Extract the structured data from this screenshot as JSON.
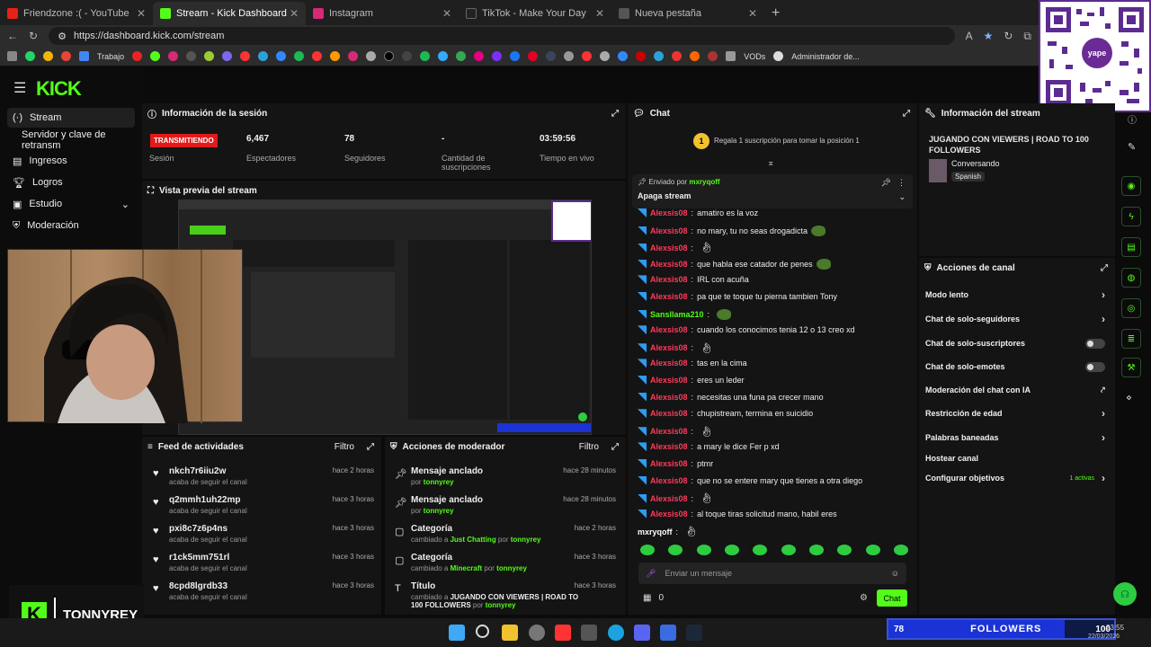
{
  "browser": {
    "tabs": [
      {
        "label": "Friendzone :( - YouTube",
        "color": "#e62117"
      },
      {
        "label": "Stream - Kick Dashboard",
        "color": "#53fc18"
      },
      {
        "label": "Instagram",
        "color": "#d62976"
      },
      {
        "label": "TikTok - Make Your Day",
        "color": "#222222"
      },
      {
        "label": "Nueva pestaña",
        "color": "#555555"
      }
    ],
    "url": "https://dashboard.kick.com/stream",
    "bookmarks": {
      "folder": "Trabajo",
      "vods": "VODs",
      "admin": "Administrador de..."
    }
  },
  "overlay": {
    "qr_brand": "yape",
    "streamer_name": "TONNYREY",
    "followers_count": "78",
    "followers_label": "FOLLOWERS",
    "followers_goal": "100",
    "followers_progress": 0.78,
    "clock_time": "23:55",
    "clock_date": "22/03/2026"
  },
  "sidebar": {
    "logo": "KICK",
    "items": [
      "Stream",
      "Servidor y clave de retransm",
      "Ingresos",
      "Logros",
      "Estudio",
      "Moderación"
    ]
  },
  "session": {
    "title": "Información de la sesión",
    "status": "TRANSMITIENDO",
    "status_label": "Sesión",
    "stats": [
      {
        "value": "6,467",
        "label": "Espectadores"
      },
      {
        "value": "78",
        "label": "Seguidores"
      },
      {
        "value": "-",
        "label": "Cantidad de suscripciones"
      },
      {
        "value": "03:59:56",
        "label": "Tiempo en vivo"
      }
    ]
  },
  "preview": {
    "title": "Vista previa del stream"
  },
  "feed": {
    "title": "Feed de actividades",
    "filter": "Filtro",
    "items": [
      {
        "name": "nkch7r6iiu2w",
        "sub": "acaba de seguir el canal",
        "time": "hace 2 horas"
      },
      {
        "name": "q2mmh1uh22mp",
        "sub": "acaba de seguir el canal",
        "time": "hace 3 horas"
      },
      {
        "name": "pxi8c7z6p4ns",
        "sub": "acaba de seguir el canal",
        "time": "hace 3 horas"
      },
      {
        "name": "r1ck5mm751rl",
        "sub": "acaba de seguir el canal",
        "time": "hace 3 horas"
      },
      {
        "name": "8cpd8lgrdb33",
        "sub": "acaba de seguir el canal",
        "time": "hace 3 horas"
      }
    ]
  },
  "mod": {
    "title": "Acciones de moderador",
    "filter": "Filtro",
    "items": [
      {
        "name": "Mensaje anclado",
        "pre": "por ",
        "a": "tonnyrey",
        "mid": "",
        "b": "",
        "time": "hace 28 minutos"
      },
      {
        "name": "Mensaje anclado",
        "pre": "por ",
        "a": "tonnyrey",
        "mid": "",
        "b": "",
        "time": "hace 28 minutos"
      },
      {
        "name": "Categoría",
        "pre": "cambiado a ",
        "a": "Just Chatting",
        "mid": " por ",
        "b": "tonnyrey",
        "time": "hace 2 horas"
      },
      {
        "name": "Categoría",
        "pre": "cambiado a ",
        "a": "Minecraft",
        "mid": " por ",
        "b": "tonnyrey",
        "time": "hace 3 horas"
      },
      {
        "name": "Título",
        "pre": "cambiado a ",
        "a": "JUGANDO CON VIEWERS | ROAD TO 100 FOLLOWERS",
        "mid": " por ",
        "b": "tonnyrey",
        "time": "hace 3 horas"
      }
    ]
  },
  "chat": {
    "title": "Chat",
    "gift_prompt": "Regala 1 suscripción para tomar la posición 1",
    "pinned_by_label": "Enviado por",
    "pinned_by": "mxryqoff",
    "pinned_msg": "Apaga stream",
    "messages": [
      {
        "user": "Alexsis08",
        "text": "amatiro es la voz",
        "extra": ""
      },
      {
        "user": "Alexsis08",
        "text": "no mary, tu no seas drogadicta",
        "extra": "emote"
      },
      {
        "user": "Alexsis08",
        "text": "",
        "extra": "hand"
      },
      {
        "user": "Alexsis08",
        "text": "que habla ese catador de penes",
        "extra": "emote"
      },
      {
        "user": "Alexsis08",
        "text": "IRL con acuña",
        "extra": ""
      },
      {
        "user": "Alexsis08",
        "text": "pa que te toque tu pierna tambien Tony",
        "extra": ""
      },
      {
        "user": "Sansllama210",
        "text": "",
        "extra": "emote"
      },
      {
        "user": "Alexsis08",
        "text": "cuando los conocimos tenia 12 o 13 creo xd",
        "extra": ""
      },
      {
        "user": "Alexsis08",
        "text": "",
        "extra": "hand"
      },
      {
        "user": "Alexsis08",
        "text": "tas en la cima",
        "extra": ""
      },
      {
        "user": "Alexsis08",
        "text": "eres un leder",
        "extra": ""
      },
      {
        "user": "Alexsis08",
        "text": "necesitas una funa pa crecer mano",
        "extra": ""
      },
      {
        "user": "Alexsis08",
        "text": "chupistream, termina en suicidio",
        "extra": ""
      },
      {
        "user": "Alexsis08",
        "text": "",
        "extra": "hand"
      },
      {
        "user": "Alexsis08",
        "text": "a mary le dice Fer p xd",
        "extra": ""
      },
      {
        "user": "Alexsis08",
        "text": "ptmr",
        "extra": ""
      },
      {
        "user": "Alexsis08",
        "text": "que no se entere mary que tienes a otra diego",
        "extra": ""
      },
      {
        "user": "Alexsis08",
        "text": "",
        "extra": "hand"
      },
      {
        "user": "Alexsis08",
        "text": "al toque tiras solicitud mano, habil eres",
        "extra": ""
      },
      {
        "user": "mxryqoff",
        "text": "",
        "extra": "hand"
      }
    ],
    "input_placeholder": "Enviar un mensaje",
    "points": "0",
    "send": "Chat"
  },
  "stream_info": {
    "title": "Información del stream",
    "stream_title": "JUGANDO CON VIEWERS | ROAD TO 100 FOLLOWERS",
    "category": "Conversando",
    "language": "Spanish"
  },
  "channel_actions": {
    "title": "Acciones de canal",
    "items": [
      {
        "label": "Modo lento",
        "control": "chevron"
      },
      {
        "label": "Chat de solo-seguidores",
        "control": "chevron"
      },
      {
        "label": "Chat de solo-suscriptores",
        "control": "toggle"
      },
      {
        "label": "Chat de solo-emotes",
        "control": "toggle"
      },
      {
        "label": "Moderación del chat con IA",
        "control": "ext"
      },
      {
        "label": "Restricción de edad",
        "control": "chevron"
      },
      {
        "label": "Palabras baneadas",
        "control": "chevron"
      },
      {
        "label": "Hostear canal",
        "control": "none"
      },
      {
        "label": "Configurar objetivos",
        "control": "chevron"
      }
    ],
    "goals_active": "1 activas"
  }
}
